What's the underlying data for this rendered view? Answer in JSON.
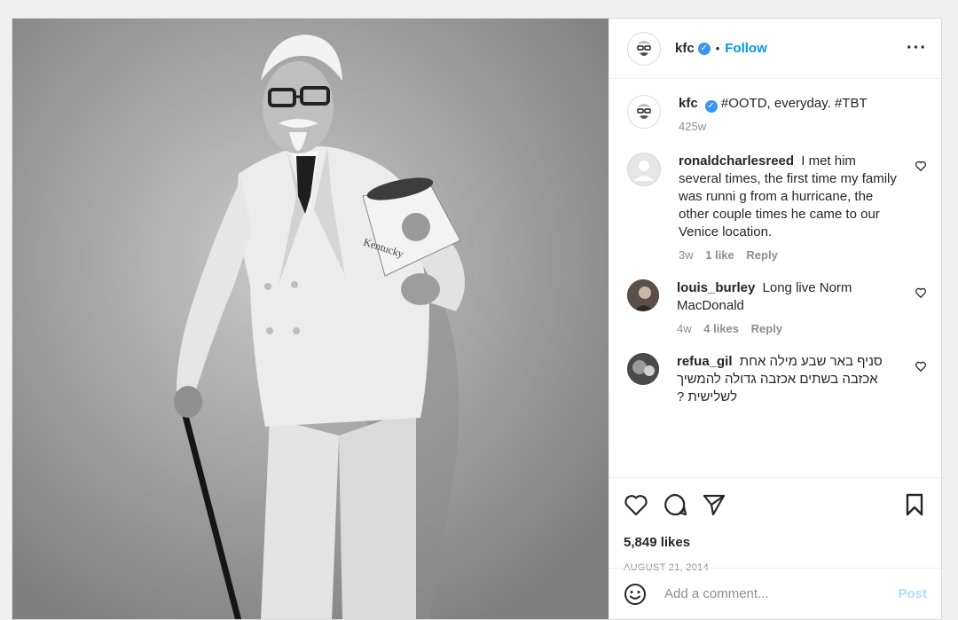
{
  "post": {
    "author": {
      "username": "kfc",
      "verified_icon": "verified-badge-icon",
      "follow_label": "Follow",
      "separator": "•"
    },
    "caption": {
      "username": "kfc",
      "text": "#OOTD, everyday. #TBT",
      "age": "425w"
    },
    "comments": [
      {
        "username": "ronaldcharlesreed",
        "text": "I met him several times, the first time my family was runni g from a hurricane, the other couple times he came to our Venice location.",
        "age": "3w",
        "likes": "1 like",
        "reply_label": "Reply"
      },
      {
        "username": "louis_burley",
        "text": "Long live Norm MacDonald",
        "age": "4w",
        "likes": "4 likes",
        "reply_label": "Reply"
      },
      {
        "username": "refua_gil",
        "text": "סניף באר שבע מילה אחת אכזבה בשתים אכזבה גדולה להמשיך לשלישית ?",
        "age": "",
        "likes": "",
        "reply_label": ""
      }
    ],
    "likes_count": "5,849 likes",
    "date": "AUGUST 21, 2014",
    "add_comment_placeholder": "Add a comment...",
    "post_label": "Post",
    "accent_color": "#0095f6",
    "icons": [
      "heart-icon",
      "comment-icon",
      "share-icon",
      "bookmark-icon",
      "emoji-icon",
      "more-options-icon"
    ]
  }
}
